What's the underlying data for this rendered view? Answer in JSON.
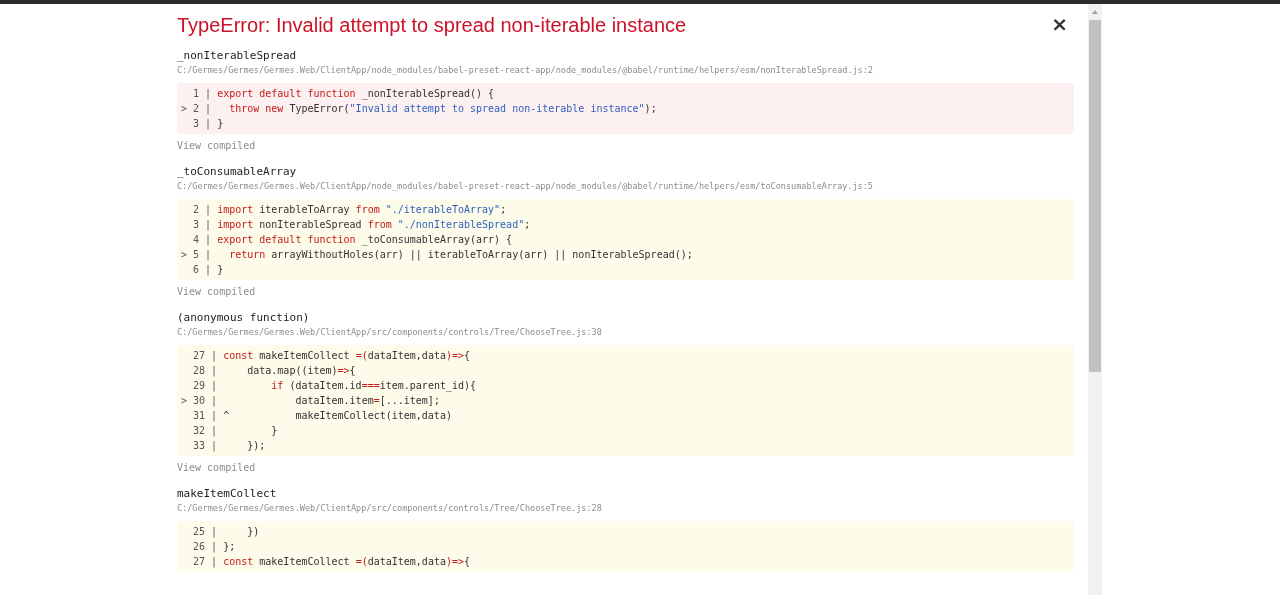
{
  "error_title": "TypeError: Invalid attempt to spread non-iterable instance",
  "close": "×",
  "frames": [
    {
      "name": "_nonIterableSpread",
      "path": "C:/Germes/Germes/Germes.Web/ClientApp/node_modules/babel-preset-react-app/node_modules/@babel/runtime/helpers/esm/nonIterableSpread.js:2",
      "kind": "error",
      "lines": [
        {
          "gutter": "  1 | ",
          "tokens": [
            {
              "kind": "keyword",
              "text": "export default function"
            },
            {
              "kind": "plain",
              "text": " _nonIterableSpread() {"
            }
          ]
        },
        {
          "gutter": "> 2 | ",
          "tokens": [
            {
              "kind": "keyword",
              "text": "  throw new"
            },
            {
              "kind": "plain",
              "text": " TypeError("
            },
            {
              "kind": "string",
              "text": "\"Invalid attempt to spread non-iterable instance\""
            },
            {
              "kind": "plain",
              "text": ");"
            }
          ]
        },
        {
          "gutter": "  3 | ",
          "tokens": [
            {
              "kind": "plain",
              "text": "}"
            }
          ]
        }
      ],
      "link": "View compiled"
    },
    {
      "name": "_toConsumableArray",
      "path": "C:/Germes/Germes/Germes.Web/ClientApp/node_modules/babel-preset-react-app/node_modules/@babel/runtime/helpers/esm/toConsumableArray.js:5",
      "kind": "context",
      "lines": [
        {
          "gutter": "  2 | ",
          "tokens": [
            {
              "kind": "keyword",
              "text": "import"
            },
            {
              "kind": "plain",
              "text": " iterableToArray "
            },
            {
              "kind": "keyword",
              "text": "from"
            },
            {
              "kind": "string",
              "text": " \"./iterableToArray\""
            },
            {
              "kind": "plain",
              "text": ";"
            }
          ]
        },
        {
          "gutter": "  3 | ",
          "tokens": [
            {
              "kind": "keyword",
              "text": "import"
            },
            {
              "kind": "plain",
              "text": " nonIterableSpread "
            },
            {
              "kind": "keyword",
              "text": "from"
            },
            {
              "kind": "string",
              "text": " \"./nonIterableSpread\""
            },
            {
              "kind": "plain",
              "text": ";"
            }
          ]
        },
        {
          "gutter": "  4 | ",
          "tokens": [
            {
              "kind": "keyword",
              "text": "export default function"
            },
            {
              "kind": "plain",
              "text": " _toConsumableArray(arr) {"
            }
          ]
        },
        {
          "gutter": "> 5 | ",
          "tokens": [
            {
              "kind": "keyword",
              "text": "  return"
            },
            {
              "kind": "plain",
              "text": " arrayWithoutHoles(arr) || iterableToArray(arr) || nonIterableSpread();"
            }
          ]
        },
        {
          "gutter": "  6 | ",
          "tokens": [
            {
              "kind": "plain",
              "text": "}"
            }
          ]
        }
      ],
      "link": "View compiled"
    },
    {
      "name": "(anonymous function)",
      "path": "C:/Germes/Germes/Germes.Web/ClientApp/src/components/controls/Tree/ChooseTree.js:30",
      "kind": "context",
      "lines": [
        {
          "gutter": "  27 | ",
          "tokens": [
            {
              "kind": "keyword",
              "text": "const"
            },
            {
              "kind": "plain",
              "text": " makeItemCollect "
            },
            {
              "kind": "keyword",
              "text": "=("
            },
            {
              "kind": "plain",
              "text": "dataItem,data"
            },
            {
              "kind": "keyword",
              "text": ")=>"
            },
            {
              "kind": "plain",
              "text": "{"
            }
          ]
        },
        {
          "gutter": "  28 | ",
          "tokens": [
            {
              "kind": "plain",
              "text": "    data.map((item)"
            },
            {
              "kind": "keyword",
              "text": "=>"
            },
            {
              "kind": "plain",
              "text": "{"
            }
          ]
        },
        {
          "gutter": "  29 | ",
          "tokens": [
            {
              "kind": "keyword",
              "text": "        if"
            },
            {
              "kind": "plain",
              "text": " (dataItem.id"
            },
            {
              "kind": "keyword",
              "text": "==="
            },
            {
              "kind": "plain",
              "text": "item.parent_id){"
            }
          ]
        },
        {
          "gutter": "> 30 | ",
          "tokens": [
            {
              "kind": "plain",
              "text": "            dataItem.item"
            },
            {
              "kind": "keyword",
              "text": "="
            },
            {
              "kind": "plain",
              "text": "[...item];"
            }
          ]
        },
        {
          "gutter": "  31 | ",
          "tokens": [
            {
              "kind": "plain",
              "text": "^           makeItemCollect(item,data)"
            }
          ]
        },
        {
          "gutter": "  32 | ",
          "tokens": [
            {
              "kind": "plain",
              "text": "        }"
            }
          ]
        },
        {
          "gutter": "  33 | ",
          "tokens": [
            {
              "kind": "plain",
              "text": "    });"
            }
          ]
        }
      ],
      "link": "View compiled"
    },
    {
      "name": "makeItemCollect",
      "path": "C:/Germes/Germes/Germes.Web/ClientApp/src/components/controls/Tree/ChooseTree.js:28",
      "kind": "context",
      "lines": [
        {
          "gutter": "  25 | ",
          "tokens": [
            {
              "kind": "plain",
              "text": "    })"
            }
          ]
        },
        {
          "gutter": "  26 | ",
          "tokens": [
            {
              "kind": "plain",
              "text": "};"
            }
          ]
        },
        {
          "gutter": "  27 | ",
          "tokens": [
            {
              "kind": "keyword",
              "text": "const"
            },
            {
              "kind": "plain",
              "text": " makeItemCollect "
            },
            {
              "kind": "keyword",
              "text": "=("
            },
            {
              "kind": "plain",
              "text": "dataItem,data"
            },
            {
              "kind": "keyword",
              "text": ")=>"
            },
            {
              "kind": "plain",
              "text": "{"
            }
          ]
        }
      ]
    }
  ]
}
